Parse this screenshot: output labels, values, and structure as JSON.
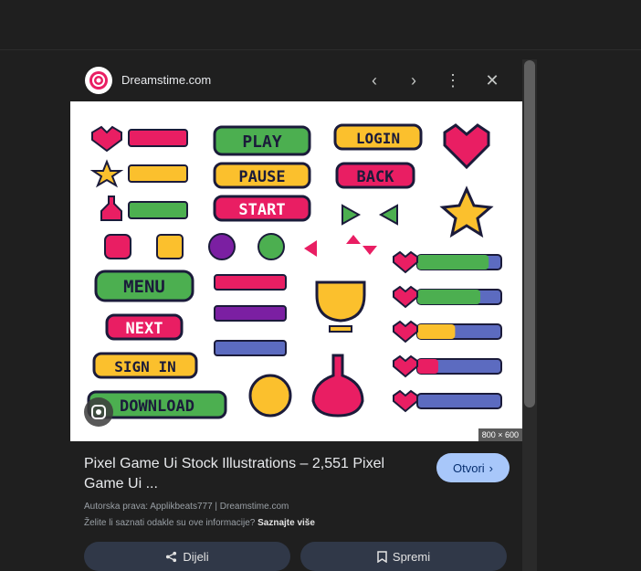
{
  "header": {
    "site_name": "Dreamstime.com"
  },
  "image": {
    "dimensions": "800 × 600",
    "labels": [
      "PLAY",
      "LOGIN",
      "PAUSE",
      "BACK",
      "START",
      "MENU",
      "NEXT",
      "SIGN IN",
      "DOWNLOAD"
    ],
    "progress_bars": [
      0.85,
      0.75,
      0.45,
      0.25,
      0.0
    ]
  },
  "result": {
    "title": "Pixel Game Ui Stock Illustrations – 2,551 Pixel Game Ui ...",
    "open_label": "Otvori",
    "credit": "Autorska prava: Applikbeats777 | Dreamstime.com",
    "info_text": "Želite li saznati odakle su ove informacije?",
    "info_link": "Saznajte više"
  },
  "actions": {
    "share_label": "Dijeli",
    "save_label": "Spremi"
  },
  "colors": {
    "accent": "#a8c7fa",
    "panel": "#1f1f1f",
    "button": "#303848"
  }
}
